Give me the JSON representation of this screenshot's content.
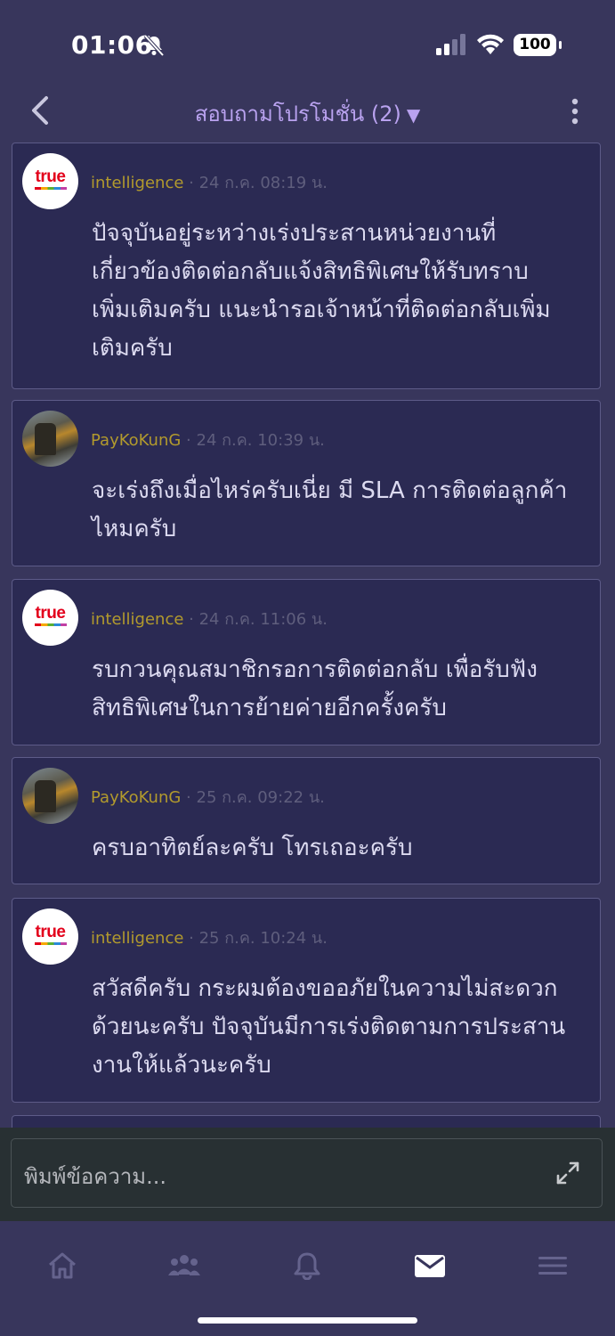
{
  "status_bar": {
    "time": "01:06",
    "battery": "100"
  },
  "header": {
    "title": "สอบถามโปรโมชั่น (2)",
    "caret": "▼"
  },
  "messages": [
    {
      "avatar": "true-logo",
      "avatar_text": "true",
      "user": "intelligence",
      "time": "24 ก.ค. 08:19 น.",
      "lines": [
        "ปัจจุบันอยู่ระหว่างเร่งประสานหน่วยงานที่",
        "เกี่ยวข้องติดต่อกลับแจ้งสิทธิพิเศษให้รับทราบ",
        "เพิ่มเติมครับ แนะนำรอเจ้าหน้าที่ติดต่อกลับเพิ่ม",
        "เติมครับ"
      ]
    },
    {
      "avatar": "user-photo",
      "avatar_text": "",
      "user": "PayKoKunG",
      "time": "24 ก.ค. 10:39 น.",
      "lines": [
        "จะเร่งถึงเมื่อไหร่ครับเนี่ย มี SLA การติดต่อลูกค้า",
        "ไหมครับ"
      ]
    },
    {
      "avatar": "true-logo",
      "avatar_text": "true",
      "user": "intelligence",
      "time": "24 ก.ค. 11:06 น.",
      "lines": [
        "รบกวนคุณสมาชิกรอการติดต่อกลับ  เพื่อรับฟัง",
        "สิทธิพิเศษในการย้ายค่ายอีกครั้งครับ"
      ]
    },
    {
      "avatar": "user-photo",
      "avatar_text": "",
      "user": "PayKoKunG",
      "time": "25 ก.ค. 09:22 น.",
      "lines": [
        "ครบอาทิตย์ละครับ โทรเถอะครับ"
      ]
    },
    {
      "avatar": "true-logo",
      "avatar_text": "true",
      "user": "intelligence",
      "time": "25 ก.ค. 10:24 น.",
      "lines": [
        "สวัสดีครับ  กระผมต้องขออภัยในความไม่สะดวก",
        "ด้วยนะครับ ปัจจุบันมีการเร่งติดตามการประสาน",
        "งานให้แล้วนะครับ"
      ]
    }
  ],
  "composer": {
    "placeholder": "พิมพ์ข้อความ..."
  },
  "tabbar": {
    "items": [
      "home-icon",
      "members-icon",
      "bell-icon",
      "mail-icon",
      "menu-icon"
    ],
    "active": "mail-icon"
  },
  "colors": {
    "background": "#38365c",
    "card": "#2b2a53",
    "accent": "#b9a2ef",
    "username": "#b29a2d"
  }
}
